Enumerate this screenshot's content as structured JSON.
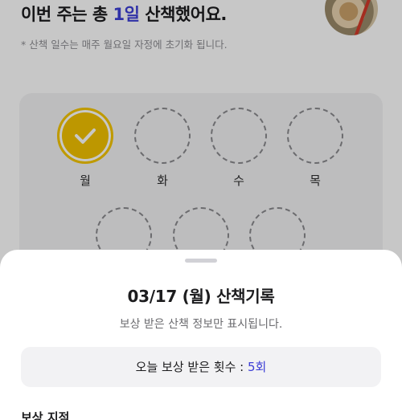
{
  "header": {
    "headline_pre": "이번 주는 총 ",
    "headline_count": "1일",
    "headline_post": " 산책했어요.",
    "note": "* 산책 일수는 매주 월요일 자정에 초기화 됩니다."
  },
  "week": {
    "days": [
      {
        "label": "월",
        "walked": true
      },
      {
        "label": "화",
        "walked": false
      },
      {
        "label": "수",
        "walked": false
      },
      {
        "label": "목",
        "walked": false
      },
      {
        "label": "",
        "walked": false
      },
      {
        "label": "",
        "walked": false
      },
      {
        "label": "",
        "walked": false
      }
    ]
  },
  "sheet": {
    "title": "03/17 (월) 산책기록",
    "subtitle": "보상 받은 산책 정보만 표시됩니다.",
    "count_label": "오늘 보상 받은 횟수 : ",
    "count_value": "5회",
    "section_title": "보상 지점"
  },
  "colors": {
    "accent": "#3d3fd6",
    "check_yellow": "#f2c200",
    "card_bg": "#f2f2f4"
  }
}
